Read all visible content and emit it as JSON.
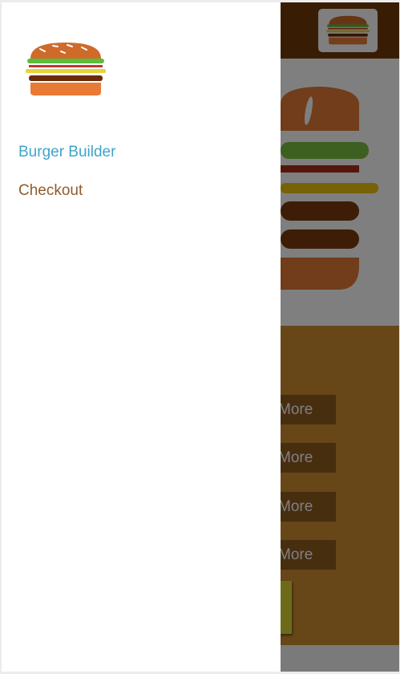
{
  "app": {
    "logo_icon": "burger-logo-icon"
  },
  "nav": {
    "items": [
      {
        "label": "Burger Builder",
        "active": true,
        "color": "#40a4c8"
      },
      {
        "label": "Checkout",
        "active": false,
        "color": "#8f5c2c"
      }
    ]
  },
  "controls": {
    "more_label": "More",
    "rows": [
      {
        "more_label": "More"
      },
      {
        "more_label": "More"
      },
      {
        "more_label": "More"
      },
      {
        "more_label": "More"
      }
    ]
  },
  "colors": {
    "toolbar": "#703b09",
    "controls_bg": "#cf8f2e",
    "control_button": "#8f5c1f",
    "order_button": "#dad735",
    "backdrop": "rgba(0,0,0,0.5)"
  }
}
